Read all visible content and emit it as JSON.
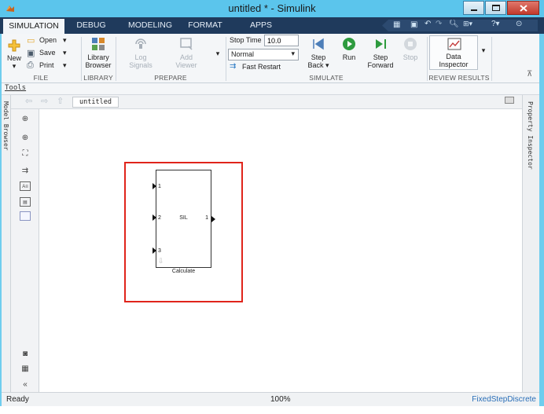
{
  "window": {
    "title": "untitled * - Simulink"
  },
  "tabs": [
    {
      "label": "SIMULATION"
    },
    {
      "label": "DEBUG"
    },
    {
      "label": "MODELING"
    },
    {
      "label": "FORMAT"
    },
    {
      "label": "APPS"
    }
  ],
  "ribbon": {
    "file": {
      "group_label": "FILE",
      "new_label": "New",
      "open_label": "Open",
      "save_label": "Save",
      "print_label": "Print"
    },
    "library": {
      "group_label": "LIBRARY",
      "browser_line1": "Library",
      "browser_line2": "Browser"
    },
    "prepare": {
      "group_label": "PREPARE",
      "log_line1": "Log",
      "log_line2": "Signals",
      "add_line1": "Add",
      "add_line2": "Viewer"
    },
    "simulate": {
      "group_label": "SIMULATE",
      "stop_time_label": "Stop Time",
      "stop_time_value": "10.0",
      "mode_value": "Normal",
      "fast_restart_label": "Fast Restart",
      "step_back_line1": "Step",
      "step_back_line2": "Back",
      "run_label": "Run",
      "step_fwd_line1": "Step",
      "step_fwd_line2": "Forward",
      "stop_label": "Stop"
    },
    "review": {
      "group_label": "REVIEW RESULTS",
      "data_line1": "Data",
      "data_line2": "Inspector"
    }
  },
  "tools_label": "Tools",
  "breadcrumb": "untitled",
  "left_tab": "Model Browser",
  "right_tab": "Property Inspector",
  "block": {
    "name": "SIL",
    "caption": "Calculate",
    "inputs": [
      "1",
      "2",
      "3"
    ],
    "output": "1"
  },
  "status": {
    "left": "Ready",
    "zoom": "100%",
    "solver": "FixedStepDiscrete"
  },
  "colors": {
    "title_bar": "#5bc5ec",
    "tab_strip": "#1f3a5c",
    "highlight_box": "#e0241b",
    "solver_text": "#2a6fb8"
  }
}
